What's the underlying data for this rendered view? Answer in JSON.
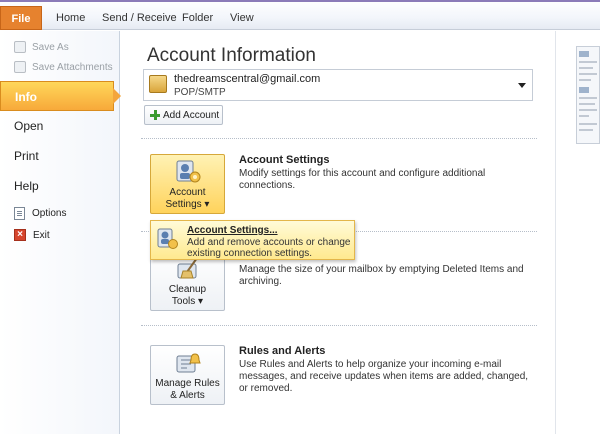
{
  "ribbon": {
    "tabs": [
      "File",
      "Home",
      "Send / Receive",
      "Folder",
      "View"
    ],
    "accent_color": "#8b7bb8",
    "file_tab_color": "#e6822e"
  },
  "leftnav": {
    "save_as": "Save As",
    "save_attachments": "Save Attachments",
    "info": "Info",
    "open": "Open",
    "print": "Print",
    "help": "Help",
    "options": "Options",
    "exit": "Exit"
  },
  "main": {
    "title": "Account Information",
    "account": {
      "email": "thedreamscentral@gmail.com",
      "type": "POP/SMTP"
    },
    "add_account_label": "Add Account",
    "sections": [
      {
        "button_label_line1": "Account",
        "button_label_line2": "Settings",
        "title": "Account Settings",
        "description": "Modify settings for this account and configure additional connections."
      },
      {
        "button_label_line1": "Cleanup",
        "button_label_line2": "Tools",
        "title": "",
        "description": "Manage the size of your mailbox by emptying Deleted Items and archiving."
      },
      {
        "button_label_line1": "Manage Rules",
        "button_label_line2": "& Alerts",
        "title": "Rules and Alerts",
        "description": "Use Rules and Alerts to help organize your incoming e-mail messages, and receive updates when items are added, changed, or removed."
      }
    ],
    "popup": {
      "title": "Account Settings...",
      "description": "Add and remove accounts or change existing connection settings."
    }
  }
}
